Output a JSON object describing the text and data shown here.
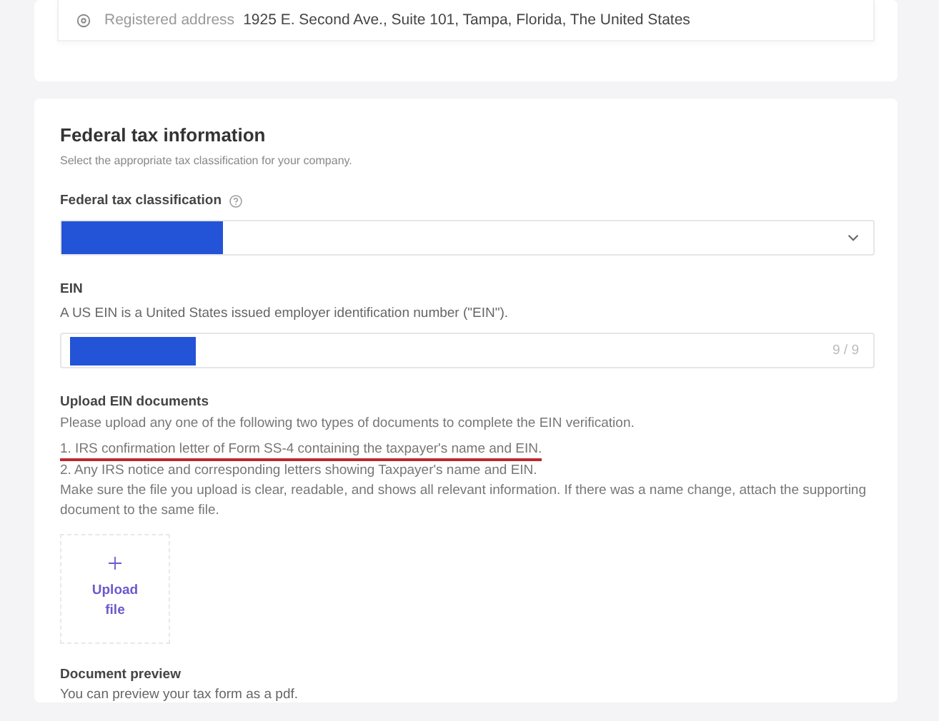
{
  "address": {
    "label": "Registered address",
    "value": "1925 E. Second Ave., Suite 101, Tampa, Florida, The United States"
  },
  "federal_tax": {
    "title": "Federal tax information",
    "subtitle": "Select the appropriate tax classification for your company.",
    "classification": {
      "label": "Federal tax classification",
      "redacted": true
    },
    "ein": {
      "label": "EIN",
      "description": "A US EIN is a United States issued employer identification number (\"EIN\").",
      "redacted": true,
      "counter": "9 / 9"
    },
    "upload": {
      "label": "Upload EIN documents",
      "lines": [
        {
          "text": "Please upload any one of the following two types of documents to complete the EIN verification.",
          "underlined": false
        },
        {
          "text": "1. IRS confirmation letter of Form SS-4 containing the taxpayer's name and EIN.",
          "underlined": true
        },
        {
          "text": "2. Any IRS notice and corresponding letters showing Taxpayer's name and EIN.",
          "underlined": false
        },
        {
          "text": "Make sure the file you upload is clear, readable, and shows all relevant information. If there was a name change, attach the supporting document to the same file.",
          "underlined": false
        }
      ],
      "button": "Upload file"
    },
    "preview": {
      "label": "Document preview",
      "description": "You can preview your tax form as a pdf."
    }
  }
}
